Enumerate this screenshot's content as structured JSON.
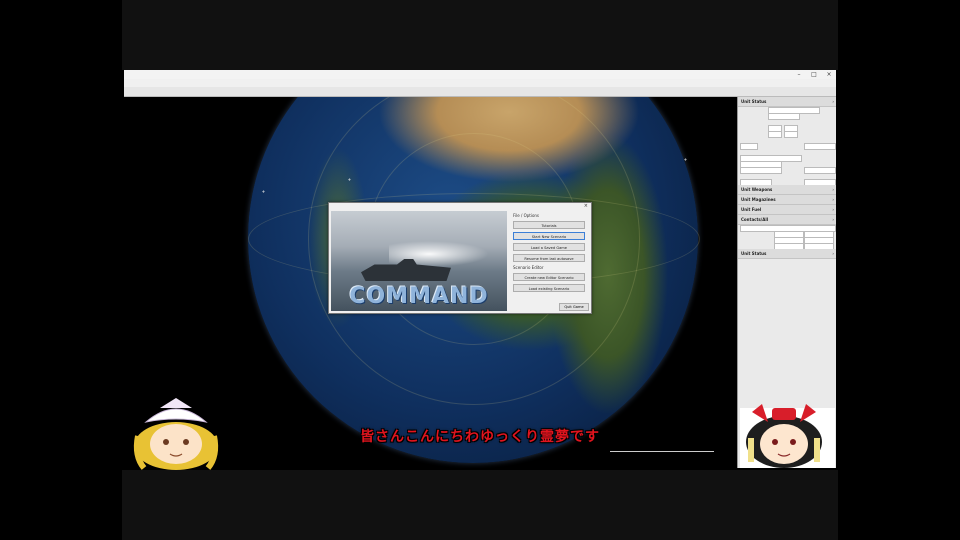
{
  "video": {
    "subtitle": "皆さんこんにちわゆっくり霊夢です"
  },
  "app": {
    "side_panel": {
      "sections": [
        {
          "label": "Unit Status"
        },
        {
          "label": "Unit Weapons"
        },
        {
          "label": "Unit Magazines"
        },
        {
          "label": "Unit Fuel"
        },
        {
          "label": "Contacts/All"
        },
        {
          "label": "Unit Status"
        }
      ]
    }
  },
  "dialog": {
    "panel_title": "File / Options",
    "buttons": [
      {
        "label": "Tutorials"
      },
      {
        "label": "Start New Scenario"
      },
      {
        "label": "Load a Saved Game"
      },
      {
        "label": "Resume from last autosave"
      }
    ],
    "section2_title": "Scenario Editor",
    "buttons2": [
      {
        "label": "Create new Editor Scenario"
      },
      {
        "label": "Load existing Scenario"
      }
    ],
    "quit_label": "Quit Game",
    "logo_text": "COMMAND"
  },
  "colors": {
    "subtitle": "#e1141e",
    "ocean": "#0f2f5e",
    "desert": "#b58d55",
    "vegetation": "#3b5527"
  }
}
